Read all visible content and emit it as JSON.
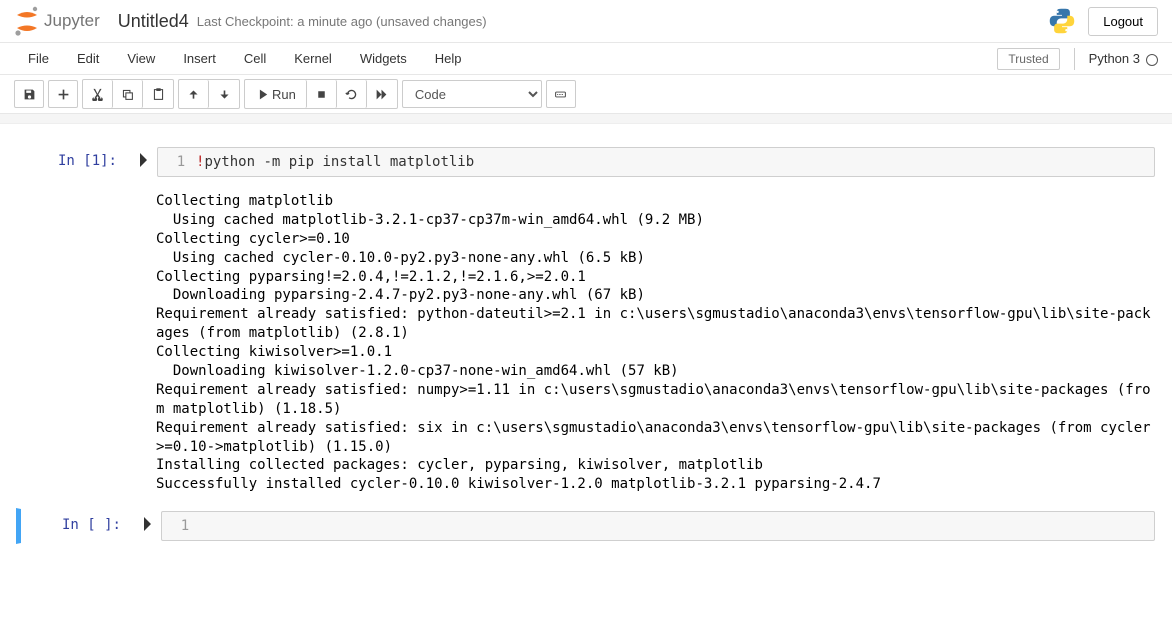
{
  "header": {
    "logo_text": "Jupyter",
    "title": "Untitled4",
    "checkpoint": "Last Checkpoint: a minute ago   (unsaved changes)",
    "logout": "Logout"
  },
  "menus": [
    "File",
    "Edit",
    "View",
    "Insert",
    "Cell",
    "Kernel",
    "Widgets",
    "Help"
  ],
  "trusted": "Trusted",
  "kernel": "Python 3",
  "toolbar": {
    "run_label": "Run",
    "cell_type": "Code"
  },
  "cells": [
    {
      "prompt": "In [1]:",
      "ln": "1",
      "code_prefix": "!",
      "code_body": "python -m pip install matplotlib",
      "output": "Collecting matplotlib\n  Using cached matplotlib-3.2.1-cp37-cp37m-win_amd64.whl (9.2 MB)\nCollecting cycler>=0.10\n  Using cached cycler-0.10.0-py2.py3-none-any.whl (6.5 kB)\nCollecting pyparsing!=2.0.4,!=2.1.2,!=2.1.6,>=2.0.1\n  Downloading pyparsing-2.4.7-py2.py3-none-any.whl (67 kB)\nRequirement already satisfied: python-dateutil>=2.1 in c:\\users\\sgmustadio\\anaconda3\\envs\\tensorflow-gpu\\lib\\site-packages (from matplotlib) (2.8.1)\nCollecting kiwisolver>=1.0.1\n  Downloading kiwisolver-1.2.0-cp37-none-win_amd64.whl (57 kB)\nRequirement already satisfied: numpy>=1.11 in c:\\users\\sgmustadio\\anaconda3\\envs\\tensorflow-gpu\\lib\\site-packages (from matplotlib) (1.18.5)\nRequirement already satisfied: six in c:\\users\\sgmustadio\\anaconda3\\envs\\tensorflow-gpu\\lib\\site-packages (from cycler>=0.10->matplotlib) (1.15.0)\nInstalling collected packages: cycler, pyparsing, kiwisolver, matplotlib\nSuccessfully installed cycler-0.10.0 kiwisolver-1.2.0 matplotlib-3.2.1 pyparsing-2.4.7"
    },
    {
      "prompt": "In [ ]:",
      "ln": "1",
      "code_prefix": "",
      "code_body": "",
      "output": ""
    }
  ]
}
